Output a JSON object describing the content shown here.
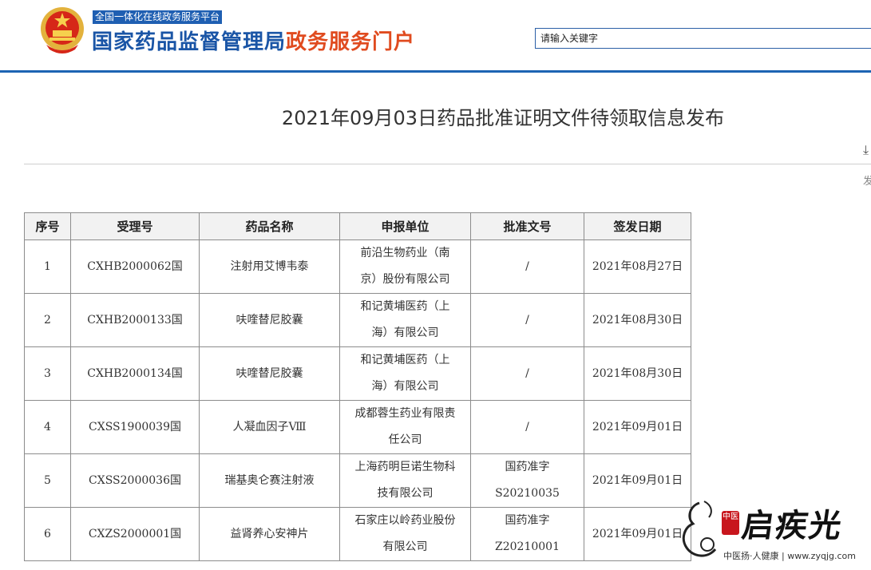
{
  "header": {
    "platform_tag": "全国一体化在线政务服务平台",
    "title_part1": "国家药品监督管理局",
    "title_part2": "政务服务门户",
    "search_placeholder": "请输入关键字"
  },
  "page": {
    "title": "2021年09月03日药品批准证明文件待领取信息发布",
    "edge_text": "发"
  },
  "table": {
    "headers": [
      "序号",
      "受理号",
      "药品名称",
      "申报单位",
      "批准文号",
      "签发日期"
    ],
    "rows": [
      {
        "no": "1",
        "acc": "CXHB2000062国",
        "drug": "注射用艾博韦泰",
        "unit_l1": "前沿生物药业（南",
        "unit_l2": "京）股份有限公司",
        "ap_l1": "/",
        "ap_l2": "",
        "date": "2021年08月27日"
      },
      {
        "no": "2",
        "acc": "CXHB2000133国",
        "drug": "呋喹替尼胶囊",
        "unit_l1": "和记黄埔医药（上",
        "unit_l2": "海）有限公司",
        "ap_l1": "/",
        "ap_l2": "",
        "date": "2021年08月30日"
      },
      {
        "no": "3",
        "acc": "CXHB2000134国",
        "drug": "呋喹替尼胶囊",
        "unit_l1": "和记黄埔医药（上",
        "unit_l2": "海）有限公司",
        "ap_l1": "/",
        "ap_l2": "",
        "date": "2021年08月30日"
      },
      {
        "no": "4",
        "acc": "CXSS1900039国",
        "drug": "人凝血因子Ⅷ",
        "unit_l1": "成都蓉生药业有限责",
        "unit_l2": "任公司",
        "ap_l1": "/",
        "ap_l2": "",
        "date": "2021年09月01日"
      },
      {
        "no": "5",
        "acc": "CXSS2000036国",
        "drug": "瑞基奥仑赛注射液",
        "unit_l1": "上海药明巨诺生物科",
        "unit_l2": "技有限公司",
        "ap_l1": "国药准字",
        "ap_l2": "S20210035",
        "date": "2021年09月01日"
      },
      {
        "no": "6",
        "acc": "CXZS2000001国",
        "drug": "益肾养心安神片",
        "unit_l1": "石家庄以岭药业股份",
        "unit_l2": "有限公司",
        "ap_l1": "国药准字",
        "ap_l2": "Z20210001",
        "date": "2021年09月01日"
      }
    ]
  },
  "watermark": {
    "brand": "启疾光",
    "seal": "中医",
    "subtitle": "中医扬·人健康 | www.zyqjg.com"
  },
  "colors": {
    "brand_blue": "#1a55a6",
    "brand_orange": "#e04b1f",
    "header_line": "#1d64b3",
    "seal_red": "#c8161d"
  }
}
